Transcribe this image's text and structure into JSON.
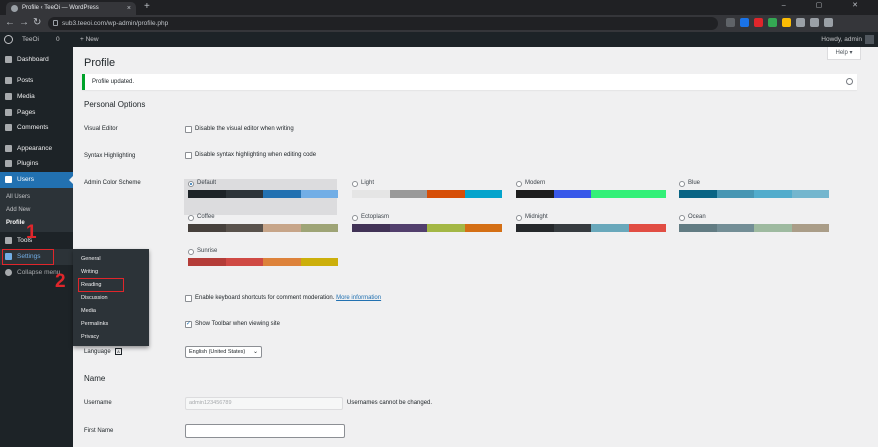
{
  "browser": {
    "tab_title": "Profile ‹ TeeOi — WordPress",
    "tab_close": "×",
    "new_tab": "+",
    "url": "sub3.teeoi.com/wp-admin/profile.php",
    "window_controls": "–  ▢  ✕"
  },
  "adminbar": {
    "site_name": "TeeOi",
    "comments_count": "0",
    "new_label": "+ New",
    "howdy": "Howdy, admin"
  },
  "sidebar": {
    "items": [
      {
        "label": "Dashboard"
      },
      {
        "label": "Posts"
      },
      {
        "label": "Media"
      },
      {
        "label": "Pages"
      },
      {
        "label": "Comments"
      },
      {
        "label": "Appearance"
      },
      {
        "label": "Plugins"
      },
      {
        "label": "Users"
      },
      {
        "label": "Tools"
      },
      {
        "label": "Settings"
      },
      {
        "label": "Collapse menu"
      }
    ],
    "users_submenu": [
      "All Users",
      "Add New",
      "Profile"
    ]
  },
  "flyout": {
    "items": [
      "General",
      "Writing",
      "Reading",
      "Discussion",
      "Media",
      "Permalinks",
      "Privacy"
    ]
  },
  "annotations": {
    "step1": "1",
    "step2": "2"
  },
  "main": {
    "help_label": "Help ▾",
    "page_title": "Profile",
    "notice": "Profile updated.",
    "personal_options_heading": "Personal Options",
    "visual_editor_label": "Visual Editor",
    "visual_editor_text": "Disable the visual editor when writing",
    "syntax_label": "Syntax Highlighting",
    "syntax_text": "Disable syntax highlighting when editing code",
    "color_scheme_label": "Admin Color Scheme",
    "color_schemes": [
      {
        "name": "Default",
        "colors": [
          "#1d2327",
          "#2c3338",
          "#2271b1",
          "#72aee6"
        ],
        "selected": true
      },
      {
        "name": "Light",
        "colors": [
          "#e5e5e5",
          "#999999",
          "#d64e07",
          "#04a4cc"
        ],
        "selected": false
      },
      {
        "name": "Modern",
        "colors": [
          "#1e1e1e",
          "#3858e9",
          "#33f078",
          "#33f078"
        ],
        "selected": false
      },
      {
        "name": "Blue",
        "colors": [
          "#096484",
          "#4796b3",
          "#52accc",
          "#74b6ce"
        ],
        "selected": false
      },
      {
        "name": "Coffee",
        "colors": [
          "#46403c",
          "#59524c",
          "#c7a589",
          "#9ea476"
        ],
        "selected": false
      },
      {
        "name": "Ectoplasm",
        "colors": [
          "#413256",
          "#523f6d",
          "#a3b745",
          "#d46f15"
        ],
        "selected": false
      },
      {
        "name": "Midnight",
        "colors": [
          "#25282b",
          "#363b3f",
          "#69a8bb",
          "#e14d43"
        ],
        "selected": false
      },
      {
        "name": "Ocean",
        "colors": [
          "#627c83",
          "#738e96",
          "#9ebaa0",
          "#aa9d88"
        ],
        "selected": false
      },
      {
        "name": "Sunrise",
        "colors": [
          "#b43c38",
          "#cf4944",
          "#dd823b",
          "#ccaf0b"
        ],
        "selected": false
      }
    ],
    "keyboard_text": "Enable keyboard shortcuts for comment moderation.",
    "keyboard_link": "More information",
    "toolbar_text": "Show Toolbar when viewing site",
    "language_label": "Language",
    "language_value": "English (United States)",
    "name_heading": "Name",
    "username_label": "Username",
    "username_value": "admin123456789",
    "username_note": "Usernames cannot be changed.",
    "firstname_label": "First Name"
  }
}
